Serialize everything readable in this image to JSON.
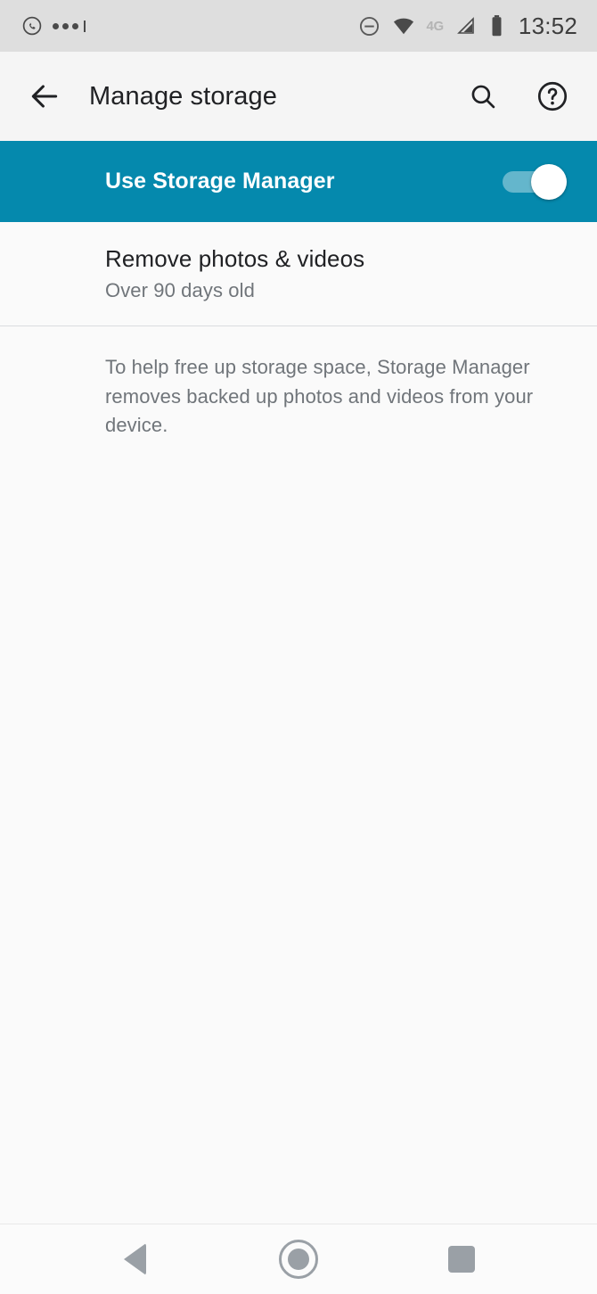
{
  "status_bar": {
    "notification_icons": [
      "whatsapp-icon",
      "more-dots-icon"
    ],
    "dnd_icon": "do-not-disturb-icon",
    "wifi_icon": "wifi-icon",
    "network_type": "4G",
    "signal_icon": "cellular-signal-icon",
    "battery_icon": "battery-icon",
    "time": "13:52",
    "background_color": "#dedede"
  },
  "app_bar": {
    "back_icon": "back-arrow-icon",
    "title": "Manage storage",
    "search_icon": "search-icon",
    "help_icon": "help-circle-icon",
    "background_color": "#f5f5f5"
  },
  "switch_banner": {
    "label": "Use Storage Manager",
    "toggle_state": "on",
    "accent_color": "#0589ad",
    "thumb_color": "#ffffff"
  },
  "list": {
    "items": [
      {
        "title": "Remove photos & videos",
        "subtitle": "Over 90 days old"
      }
    ]
  },
  "footer": {
    "note": "To help free up storage space, Storage Manager removes backed up photos and videos from your device."
  },
  "nav_bar": {
    "back_label": "back-button",
    "home_label": "home-button",
    "recents_label": "recents-button",
    "icon_color": "#9aa0a6"
  }
}
